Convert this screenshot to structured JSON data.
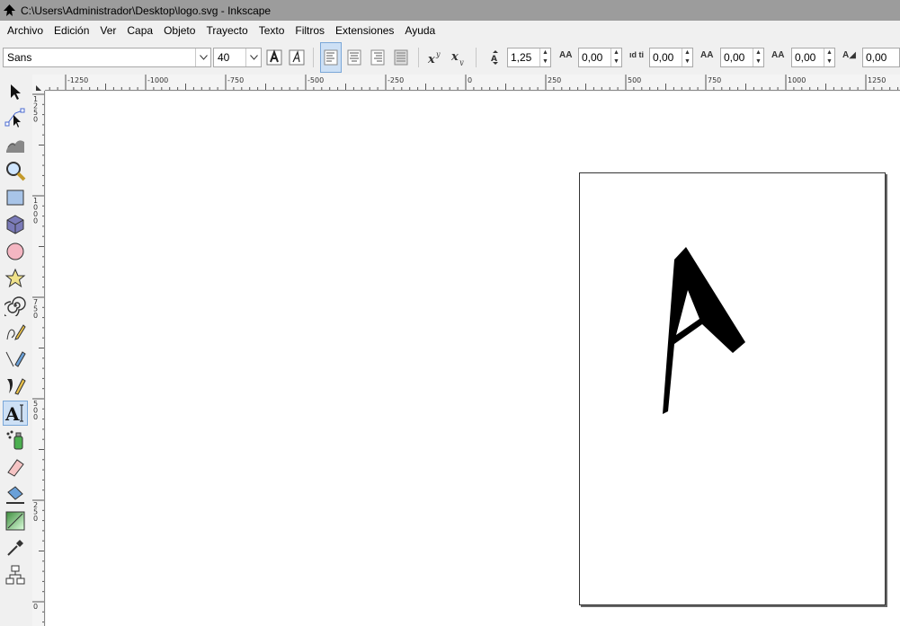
{
  "window": {
    "title": "C:\\Users\\Administrador\\Desktop\\logo.svg - Inkscape"
  },
  "menu": [
    "Archivo",
    "Edición",
    "Ver",
    "Capa",
    "Objeto",
    "Trayecto",
    "Texto",
    "Filtros",
    "Extensiones",
    "Ayuda"
  ],
  "text_toolbar": {
    "font_family": "Sans",
    "font_size": "40",
    "line_spacing": "1,25",
    "letter_spacing": "0,00",
    "word_spacing": "0,00",
    "kerning": "0,00",
    "vertical_shift": "0,00",
    "rotation": "0,00",
    "align_options": [
      "align-left-icon",
      "align-center-icon",
      "align-right-icon",
      "justify-icon"
    ],
    "active_alignment": "align-left-icon"
  },
  "rulers": {
    "horizontal_labels": [
      "-1250",
      "-1000",
      "-750",
      "-500",
      "-250",
      "0",
      "250",
      "500",
      "750",
      "1000",
      "1250"
    ],
    "vertical_labels": [
      "1250",
      "1000",
      "750",
      "500",
      "250",
      "0"
    ]
  },
  "tools": [
    "selector-icon",
    "node-icon",
    "tweak-icon",
    "zoom-icon",
    "rectangle-icon",
    "3d-box-icon",
    "ellipse-icon",
    "star-icon",
    "spiral-icon",
    "pencil-icon",
    "pen-icon",
    "calligraphy-icon",
    "text-tool-icon",
    "spray-icon",
    "eraser-icon",
    "paint-bucket-icon",
    "gradient-icon",
    "dropper-icon",
    "connector-icon"
  ],
  "active_tool": "text-tool-icon",
  "colors": {
    "titlebar": "#9c9c9c",
    "active_tool_bg": "#cde0f5",
    "glyph": "#000000"
  }
}
